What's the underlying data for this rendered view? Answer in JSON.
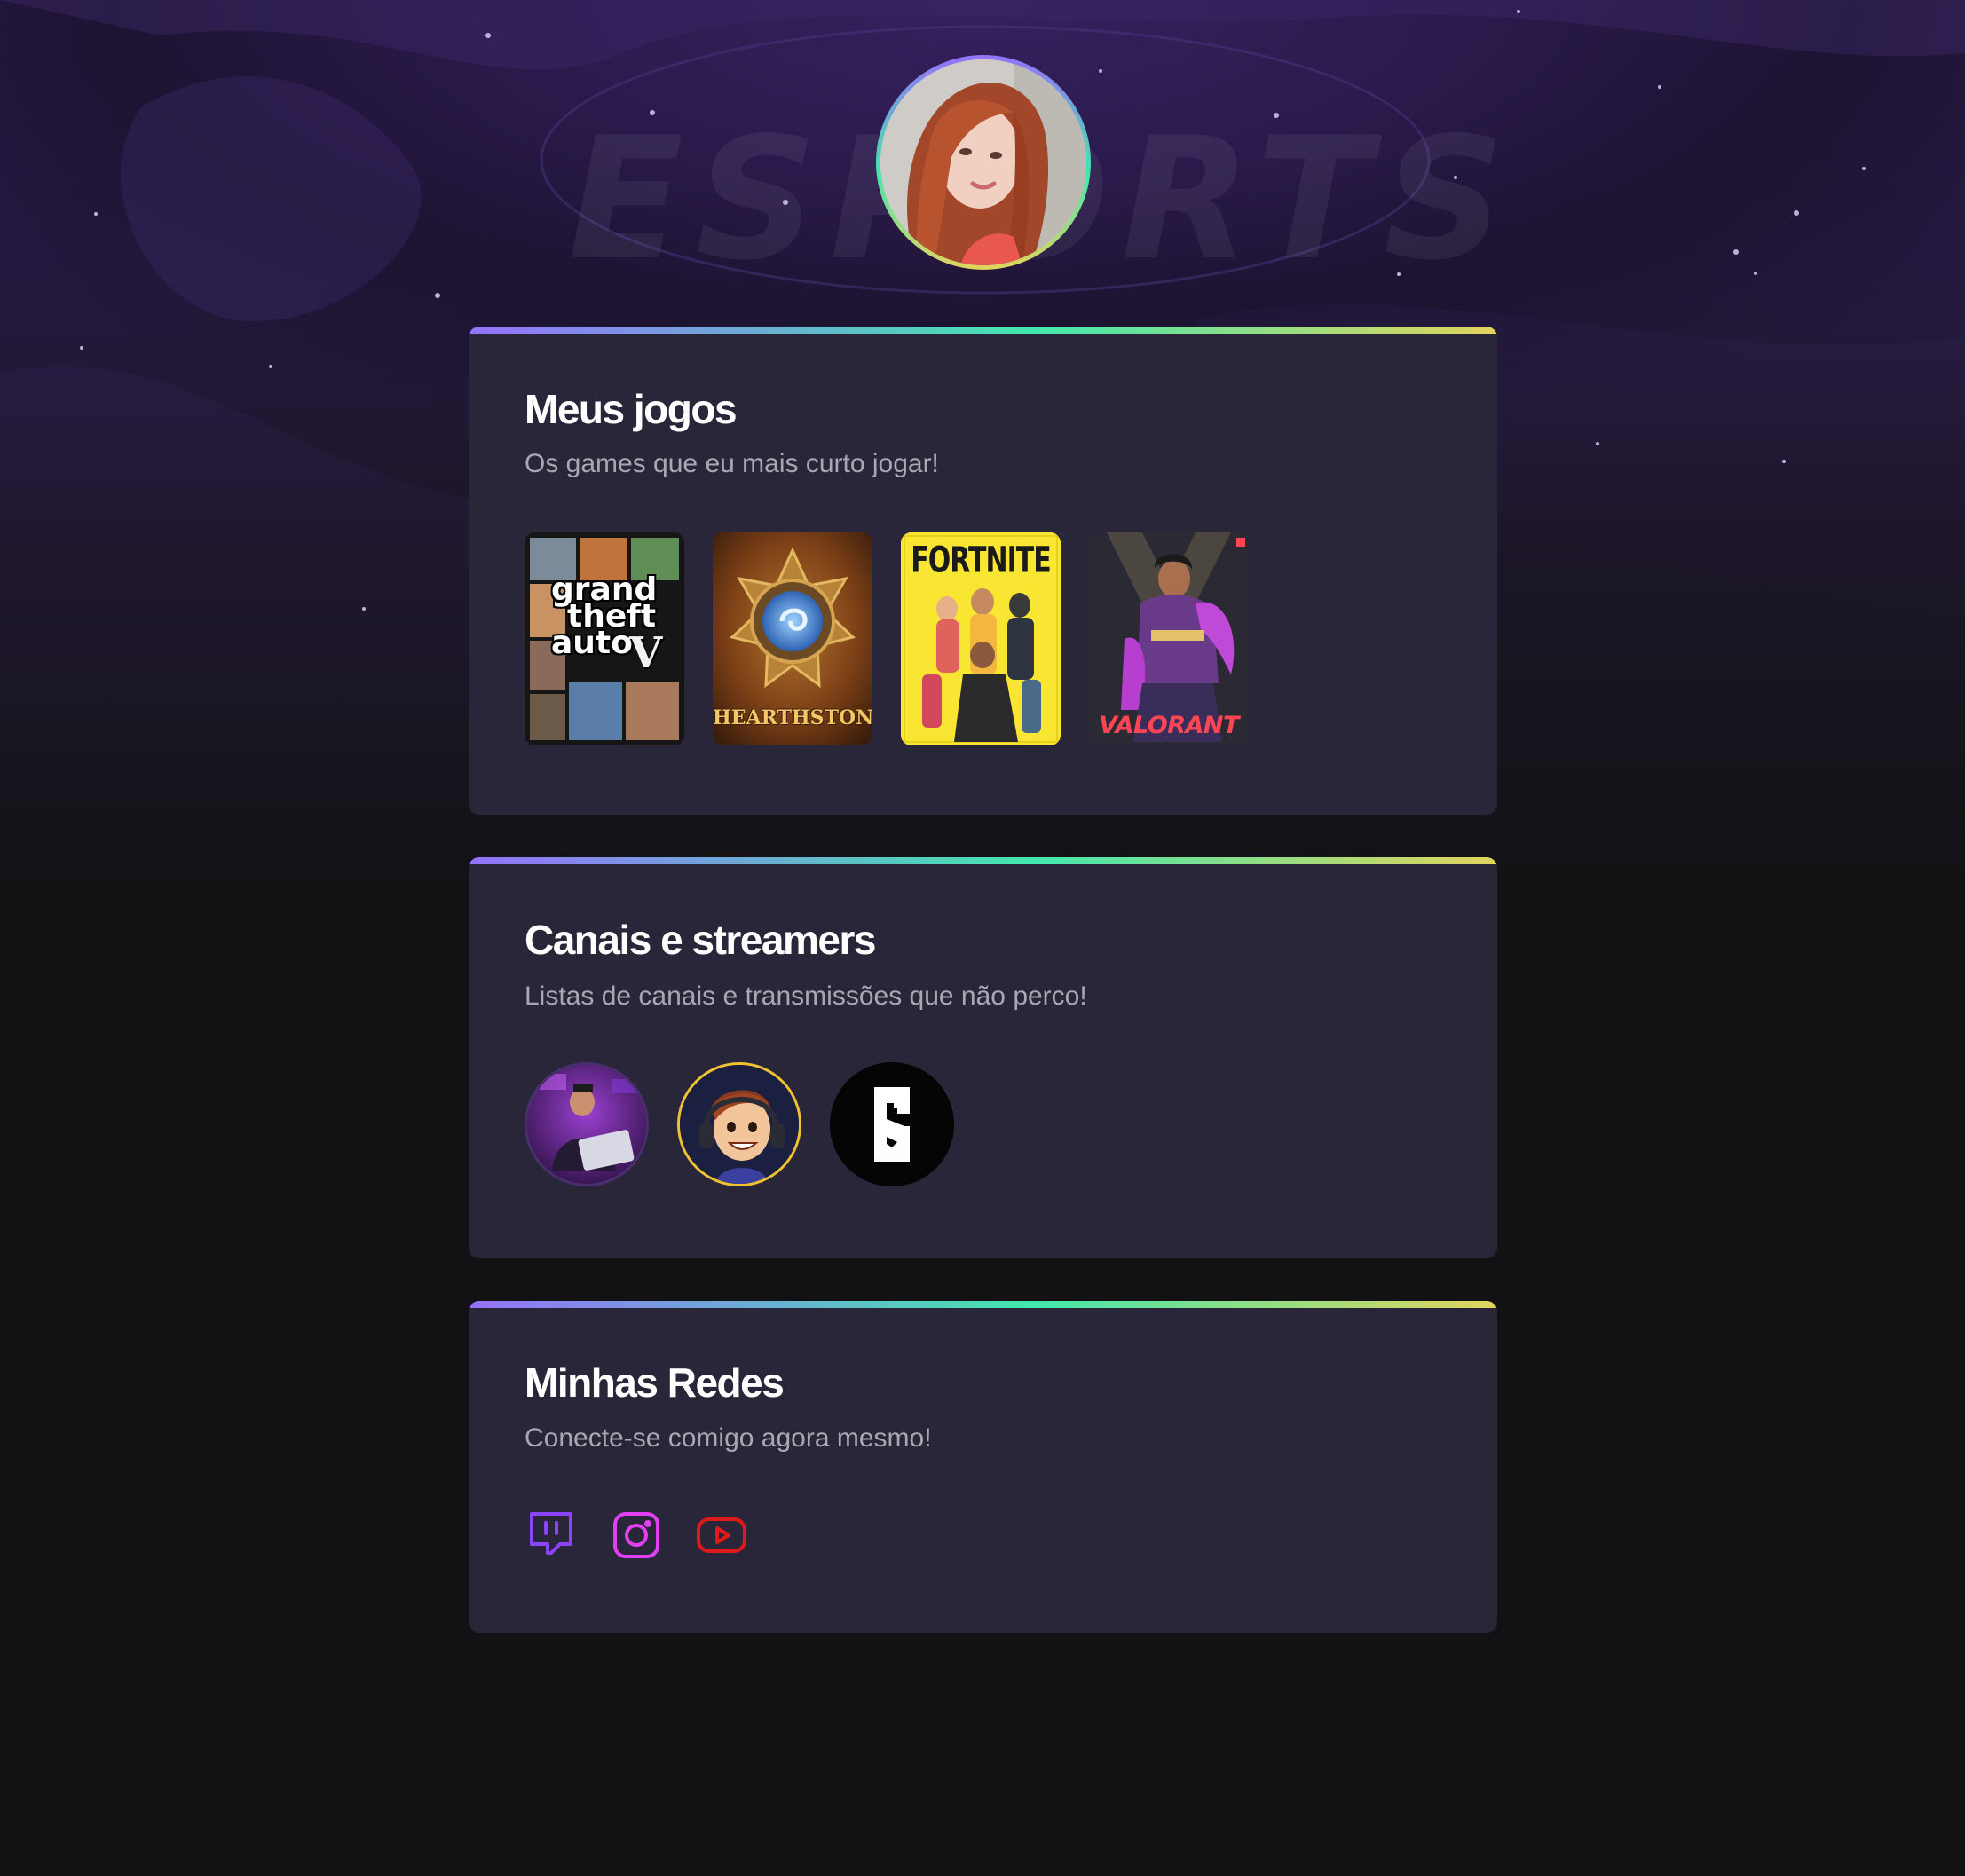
{
  "background": {
    "watermark_text": "ESPORTS",
    "colors": {
      "top": "#2d1c50",
      "bottom": "#121214",
      "accent_gradient": [
        "#9572fc",
        "#43e7ad",
        "#e2d45c"
      ]
    }
  },
  "profile": {
    "avatar_alt": "profile-photo"
  },
  "games_section": {
    "title": "Meus jogos",
    "subtitle": "Os games que eu mais curto jogar!",
    "games": [
      {
        "name": "grand theft auto V",
        "cover_text_lines": [
          "grand",
          "theft",
          "auto"
        ],
        "badge": "V"
      },
      {
        "name": "Hearthstone",
        "cover_text": "HEARTHSTONE"
      },
      {
        "name": "Fortnite",
        "cover_text": "FORTNITE"
      },
      {
        "name": "Valorant",
        "cover_text": "VALORANT"
      }
    ]
  },
  "streamers_section": {
    "title": "Canais e streamers",
    "subtitle": "Listas de canais e transmissões que não perco!",
    "channels": [
      {
        "icon": "streamer-laptop-avatar"
      },
      {
        "icon": "cartoon-headset-avatar"
      },
      {
        "icon": "esports-logo-avatar"
      }
    ]
  },
  "socials_section": {
    "title": "Minhas Redes",
    "subtitle": "Conecte-se comigo agora mesmo!",
    "links": [
      {
        "icon": "twitch-icon",
        "color": "#8b44f7"
      },
      {
        "icon": "instagram-icon",
        "color": "#e23ef2"
      },
      {
        "icon": "youtube-icon",
        "color": "#e01919"
      }
    ]
  }
}
